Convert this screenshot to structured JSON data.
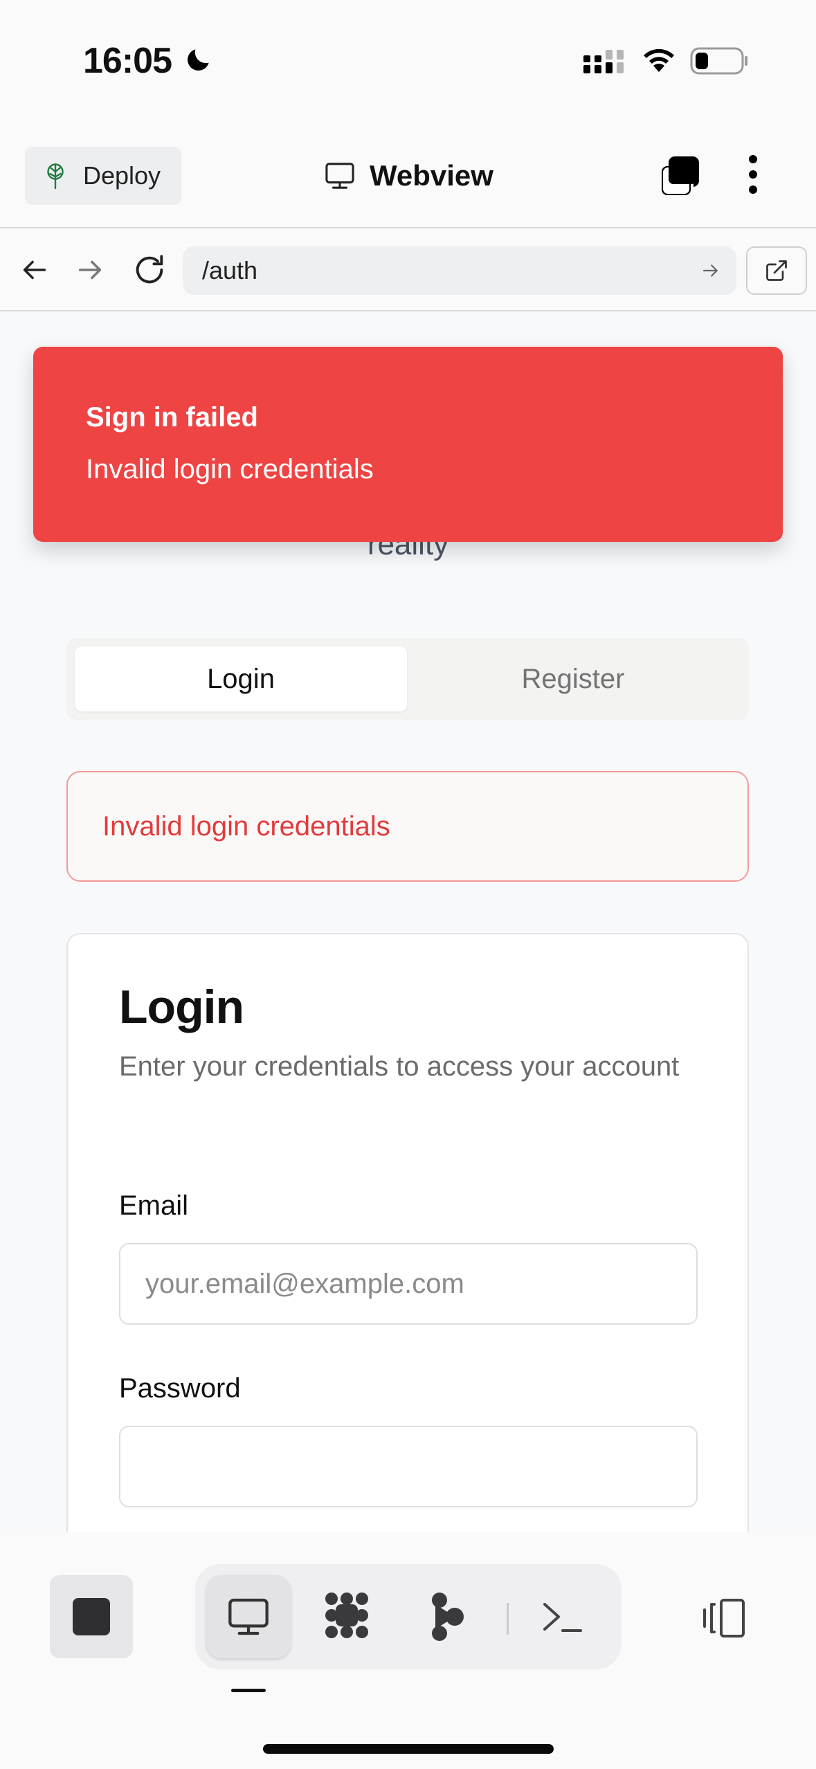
{
  "status_bar": {
    "time": "16:05"
  },
  "top_bar": {
    "deploy_label": "Deploy",
    "title": "Webview"
  },
  "url_bar": {
    "url": "/auth"
  },
  "brand": {
    "text": "reality"
  },
  "toast": {
    "title": "Sign in failed",
    "description": "Invalid login credentials"
  },
  "auth_tabs": {
    "login": "Login",
    "register": "Register",
    "selected": "Login"
  },
  "error_alert": {
    "message": "Invalid login credentials"
  },
  "login_card": {
    "title": "Login",
    "subtitle": "Enter your credentials to access your account",
    "email_label": "Email",
    "email_placeholder": "your.email@example.com",
    "email_value": "",
    "password_label": "Password",
    "password_value": ""
  },
  "bottom_toolbar": {
    "tools": [
      "webview-icon",
      "plugins-icon",
      "git-icon",
      "terminal-icon"
    ],
    "active_tool": "webview-icon"
  },
  "colors": {
    "toast_bg": "#ef4444",
    "error_text": "#e23b3b",
    "error_border": "#f29a9a",
    "deploy_icon": "#1f7a3d"
  }
}
